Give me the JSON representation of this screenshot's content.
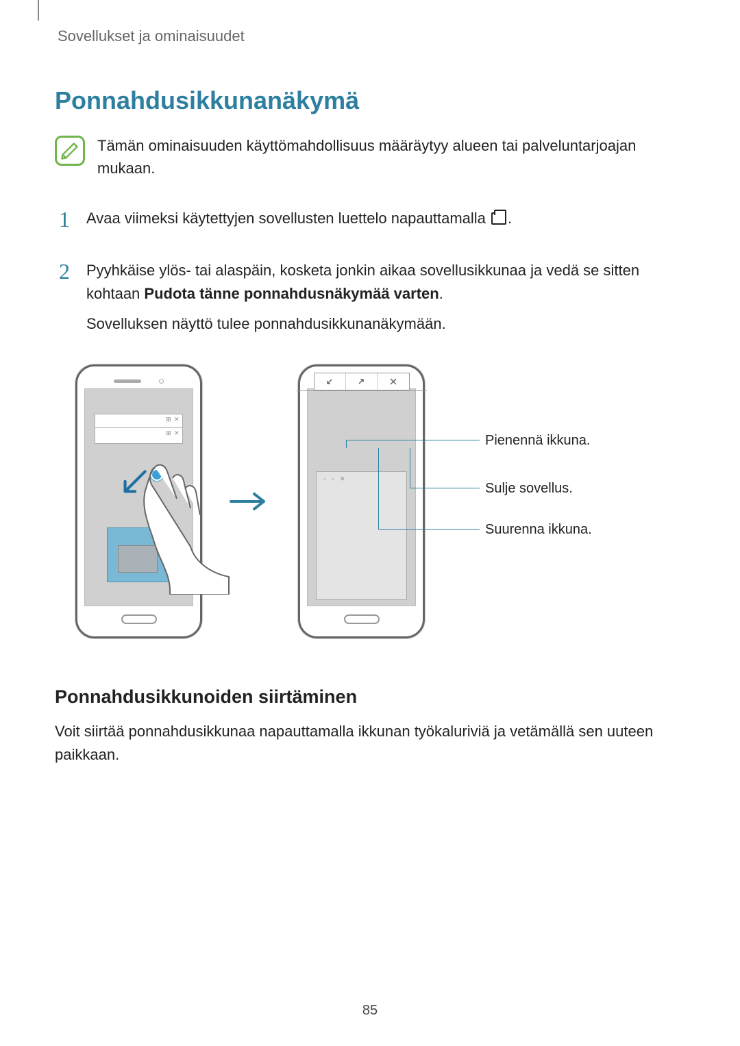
{
  "breadcrumb": "Sovellukset ja ominaisuudet",
  "heading1": "Ponnahdusikkunanäkymä",
  "note": "Tämän ominaisuuden käyttömahdollisuus määräytyy alueen tai palveluntarjoajan mukaan.",
  "steps": [
    {
      "num": "1",
      "text_before_icon": "Avaa viimeksi käytettyjen sovellusten luettelo napauttamalla ",
      "text_after_icon": "."
    },
    {
      "num": "2",
      "line1_plain": "Pyyhkäise ylös- tai alaspäin, kosketa jonkin aikaa sovellusikkunaa ja vedä se sitten kohtaan ",
      "line1_bold": "Pudota tänne ponnahdusnäkymää varten",
      "line1_end": ".",
      "line2": "Sovelluksen näyttö tulee ponnahdusikkunanäkymään."
    }
  ],
  "callouts": {
    "minimize": "Pienennä ikkuna.",
    "close": "Sulje sovellus.",
    "maximize": "Suurenna ikkuna."
  },
  "heading2": "Ponnahdusikkunoiden siirtäminen",
  "body2": "Voit siirtää ponnahdusikkunaa napauttamalla ikkunan työkaluriviä ja vetämällä sen uuteen paikkaan.",
  "page_number": "85"
}
